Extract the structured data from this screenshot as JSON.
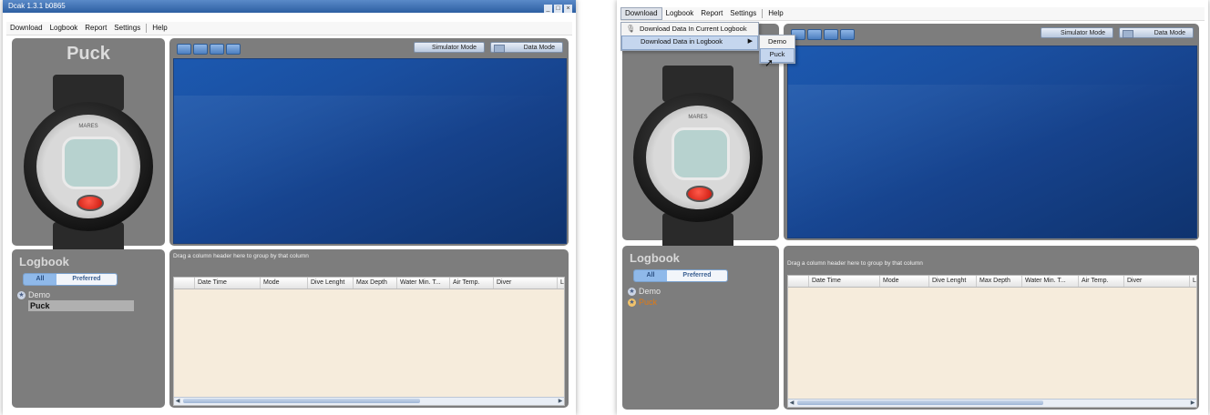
{
  "app": {
    "title": "Dcak 1.3.1 b0865",
    "window_controls": [
      "_",
      "□",
      "×"
    ]
  },
  "menu": {
    "items": [
      "Download",
      "Logbook",
      "Report",
      "Settings",
      "Help"
    ]
  },
  "device": {
    "name": "Puck",
    "brand": "MARES"
  },
  "toolbar": {
    "simulator_mode": "Simulator Mode",
    "data_mode": "Data Mode"
  },
  "logbook": {
    "title": "Logbook",
    "filter_all": "All",
    "filter_preferred": "Preferred",
    "items": [
      "Demo",
      "Puck"
    ]
  },
  "grid": {
    "group_hint": "Drag a column header here to group by that column",
    "columns": [
      "Date Time",
      "Mode",
      "Dive Lenght",
      "Max Depth",
      "Water Min. T...",
      "Air Temp.",
      "Diver",
      "Lo"
    ]
  },
  "download_menu": {
    "items": [
      "Download Data In Current Logbook",
      "Download Data in Logbook"
    ],
    "submenu": [
      "Demo",
      "Puck"
    ]
  },
  "colors": {
    "accent": "#2d5fa2",
    "panel": "#7d7d7d",
    "grid_bg": "#f6ecdc",
    "ocean": "#16418a",
    "highlight": "#e07a14"
  }
}
